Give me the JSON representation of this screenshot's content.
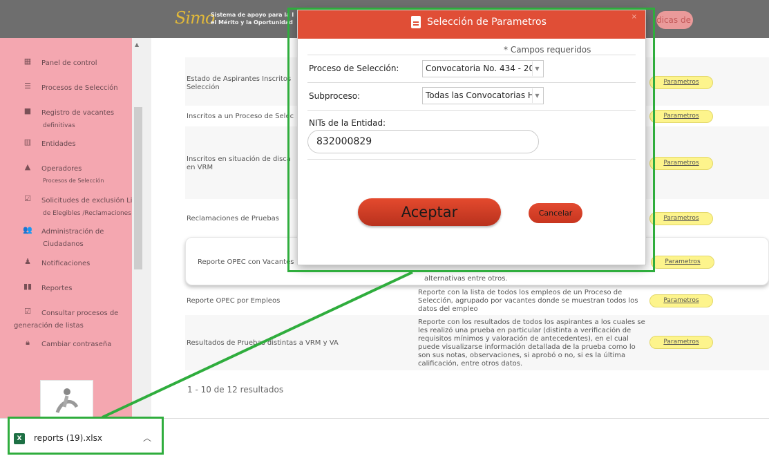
{
  "header": {
    "logo_mark": "Simo",
    "logo_text_line1": "Sistema de apoyo para la Igualdad,",
    "logo_text_line2": "el Mérito y la Oportunidad",
    "terms_label": "dicas de uso"
  },
  "sidebar": {
    "items": [
      {
        "label": "Panel de control",
        "icon": "dashboard-icon"
      },
      {
        "label": "Procesos de Selección",
        "icon": "list-icon"
      },
      {
        "label": "Registro de vacantes",
        "sub": "definitivas",
        "icon": "briefcase-icon"
      },
      {
        "label": "Entidades",
        "icon": "building-icon"
      },
      {
        "label": "Operadores",
        "sub": "Procesos de Selección",
        "icon": "graduation-cap-icon"
      },
      {
        "label": "Solicitudes de exclusión Lis",
        "sub": "de Elegibles /Reclamaciones",
        "icon": "checkbox-icon"
      },
      {
        "label": "Administración de",
        "sub": "Ciudadanos",
        "icon": "users-icon"
      },
      {
        "label": "Notificaciones",
        "icon": "bell-icon"
      },
      {
        "label": "Reportes",
        "icon": "bar-chart-icon"
      },
      {
        "label": "Consultar procesos de",
        "sub": "generación de listas",
        "icon": "checkbox-icon"
      },
      {
        "label": "Cambiar contraseña",
        "icon": "lock-icon"
      }
    ]
  },
  "reports": {
    "param_label": "Parametros",
    "rows": [
      {
        "name": "Estado de Aspirantes Inscritos",
        "name2": "Selección",
        "desc": ""
      },
      {
        "name": "Inscritos a un Proceso de Selec",
        "desc": ""
      },
      {
        "name": "Inscritos en situación de disca",
        "name2": "en VRM",
        "desc": ""
      },
      {
        "name": "Reclamaciones de Pruebas",
        "desc": ""
      },
      {
        "name": "Reporte OPEC con Vacantes",
        "desc": "alternativas entre otros."
      },
      {
        "name": "Reporte OPEC por Empleos",
        "desc": "Reporte con la lista de todos los empleos de un Proceso de Selección, agrupado por vacantes donde se muestran todos los datos del empleo"
      },
      {
        "name": "Resultados de Pruebas distintas a VRM y VA",
        "desc": "Reporte con los resultados de todos los aspirantes a los cuales se les realizó una prueba en particular (distinta a verificación de requisitos mínimos y valoración de antecedentes), en el cual puede visualizarse información detallada de la prueba como lo son sus notas, observaciones, si aprobó o no, si es la última calificación, entre otros datos."
      }
    ],
    "pagination": "1 - 10 de 12 resultados"
  },
  "modal": {
    "title": "Selección de Parametros",
    "close": "×",
    "required_note": "* Campos requeridos",
    "proceso_label": "Proceso de Selección:",
    "proceso_value": "Convocatoria No. 434 - 20",
    "subproceso_label": "Subproceso:",
    "subproceso_value": "Todas las Convocatorias Hi",
    "nits_label": "NITs de la Entidad:",
    "nits_value": "832000829",
    "accept_label": "Aceptar",
    "cancel_label": "Cancelar"
  },
  "download": {
    "file_name": "reports (19).xlsx",
    "icon": "excel-file-icon"
  },
  "colors": {
    "header_bg": "#6e6e6e",
    "sidebar_bg": "#f4a7b0",
    "modal_header": "#e04e36",
    "param_button": "#fdf48c",
    "annotation_green": "#2fad3d"
  }
}
